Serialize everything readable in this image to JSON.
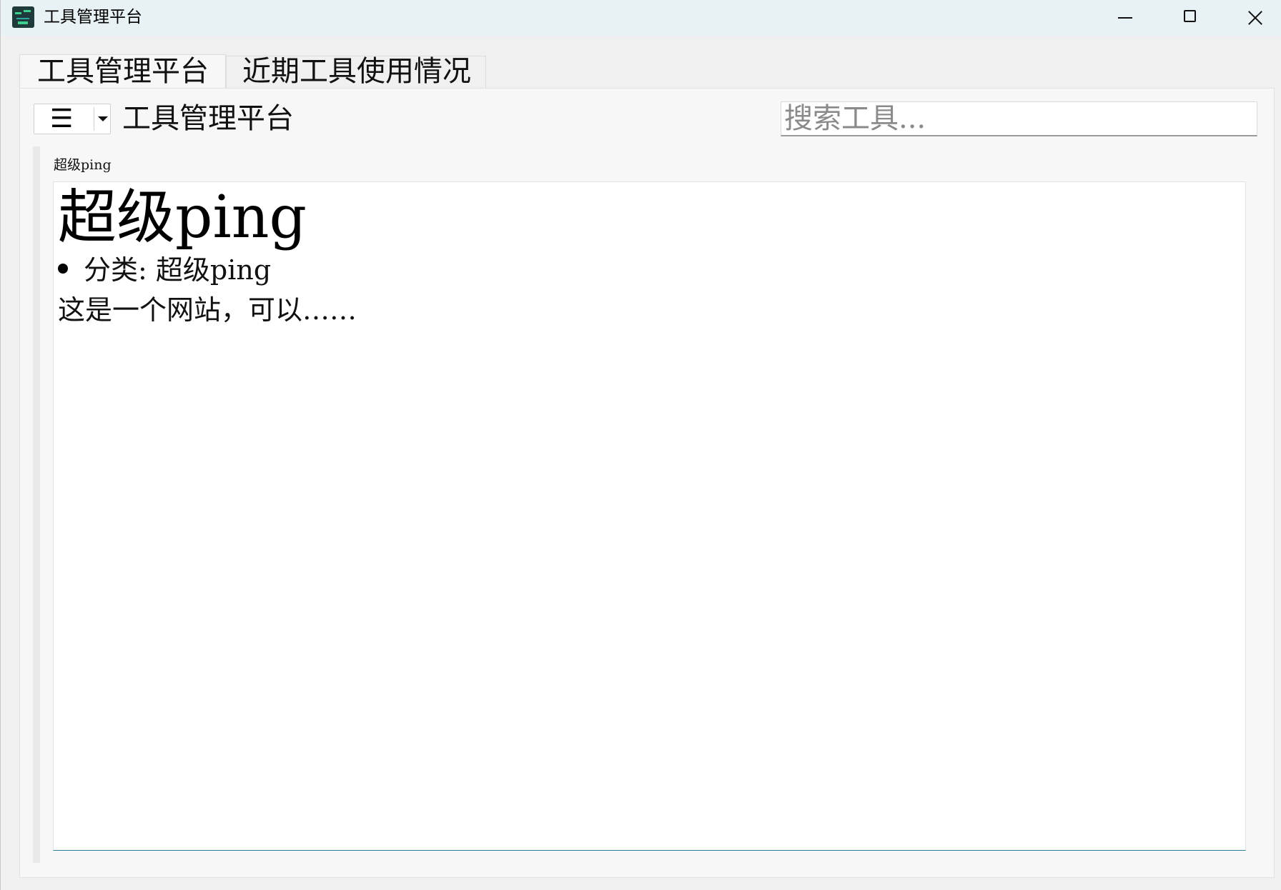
{
  "window": {
    "title": "工具管理平台",
    "controls": {
      "minimize": "minimize",
      "maximize": "maximize",
      "close": "close"
    }
  },
  "tabs": [
    {
      "label": "工具管理平台",
      "active": true
    },
    {
      "label": "近期工具使用情况",
      "active": false
    }
  ],
  "toolbar": {
    "menu_glyph": "☰",
    "title": "工具管理平台",
    "search_placeholder": "搜索工具..."
  },
  "tool_card": {
    "label": "超级ping",
    "heading": "超级ping",
    "category_text": "分类: 超级ping",
    "description": "这是一个网站，可以……"
  },
  "colors": {
    "titlebar_bg": "#e8f2f4",
    "window_bg": "#f0f0f0",
    "content_bg": "#ffffff",
    "focus_line": "#2c7d95"
  }
}
